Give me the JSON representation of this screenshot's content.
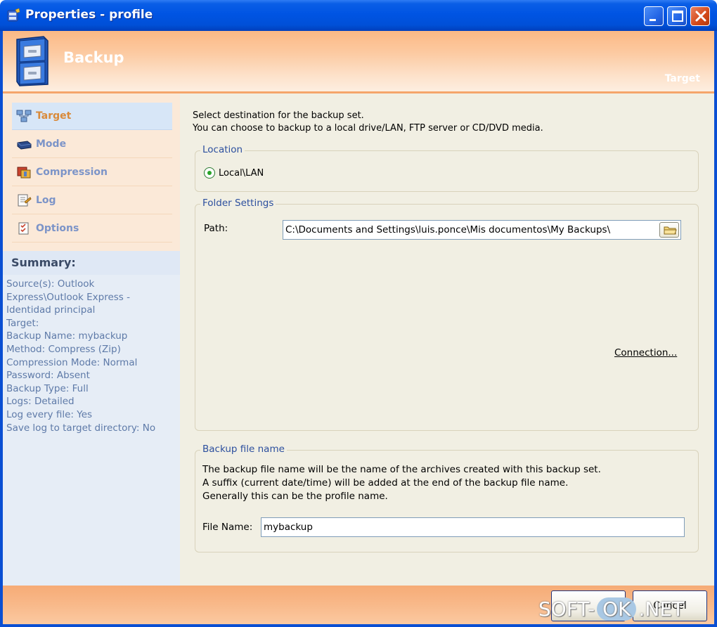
{
  "window": {
    "title": "Properties - profile",
    "buttons": [
      "minimize",
      "maximize",
      "close"
    ]
  },
  "banner": {
    "title": "Backup",
    "subtitle": "Target"
  },
  "sidebar": {
    "items": [
      {
        "label": "Target",
        "icon": "target-network-icon",
        "active": true
      },
      {
        "label": "Mode",
        "icon": "mode-disk-icon",
        "active": false
      },
      {
        "label": "Compression",
        "icon": "compression-icon",
        "active": false
      },
      {
        "label": "Log",
        "icon": "log-icon",
        "active": false
      },
      {
        "label": "Options",
        "icon": "options-icon",
        "active": false
      }
    ],
    "summary_title": "Summary:",
    "summary_lines": [
      "Source(s): Outlook",
      "Express\\Outlook Express -",
      "Identidad principal",
      "Target:",
      "Backup Name: mybackup",
      "Method: Compress (Zip)",
      "Compression Mode: Normal",
      "Password: Absent",
      "Backup Type: Full",
      "Logs: Detailed",
      "Log every file: Yes",
      "Save log to target directory: No"
    ]
  },
  "content": {
    "intro_line1": "Select destination for the backup set.",
    "intro_line2": "You can choose to backup to a local drive/LAN, FTP server or CD/DVD media.",
    "location": {
      "label": "Location",
      "option": "Local\\LAN",
      "selected": true
    },
    "folder_settings": {
      "label": "Folder Settings",
      "path_label": "Path:",
      "path_value": "C:\\Documents and Settings\\luis.ponce\\Mis documentos\\My Backups\\",
      "connection_link": "Connection..."
    },
    "backup_file_name": {
      "label": "Backup file name",
      "desc_line1": "The backup file name will be the name of the archives created with this backup set.",
      "desc_line2": "A suffix (current date/time) will be added at the end of the backup file name.",
      "desc_line3": "Generally this can be the profile name.",
      "file_name_label": "File Name:",
      "file_name_value": "mybackup"
    }
  },
  "footer": {
    "cancel_label": "Cancel",
    "watermark_left": "SOFT-",
    "watermark_mid": "OK",
    "watermark_right": ".NET"
  },
  "colors": {
    "titlebar": "#0054e3",
    "banner": "#fbb985",
    "sidebar": "#fbe9d8",
    "active_nav": "#d7e6f7",
    "group_label": "#2c4f9e",
    "summary_text": "#5e7aa8"
  }
}
